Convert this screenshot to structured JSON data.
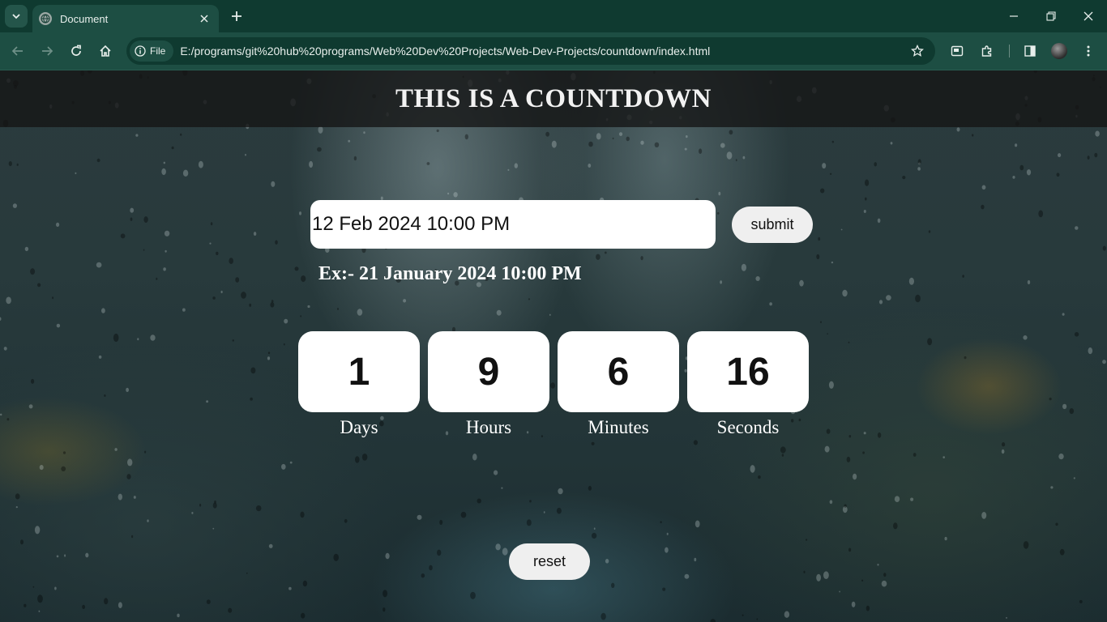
{
  "browser": {
    "tab": {
      "title": "Document"
    },
    "site_chip": "File",
    "url": "E:/programs/git%20hub%20programs/Web%20Dev%20Projects/Web-Dev-Projects/countdown/index.html"
  },
  "page": {
    "title": "THIS IS A COUNTDOWN",
    "date_input": {
      "value": "12 Feb 2024 10:00 PM"
    },
    "submit_label": "submit",
    "example_hint": "Ex:- 21 January 2024 10:00 PM",
    "countdown": [
      {
        "value": "1",
        "label": "Days"
      },
      {
        "value": "9",
        "label": "Hours"
      },
      {
        "value": "6",
        "label": "Minutes"
      },
      {
        "value": "16",
        "label": "Seconds"
      }
    ],
    "reset_label": "reset"
  },
  "colors": {
    "chrome_dark": "#0f3a30",
    "chrome_toolbar": "#1d4e43",
    "header_bar": "#141414",
    "box_bg": "#ffffff",
    "button_bg": "#efefef"
  }
}
